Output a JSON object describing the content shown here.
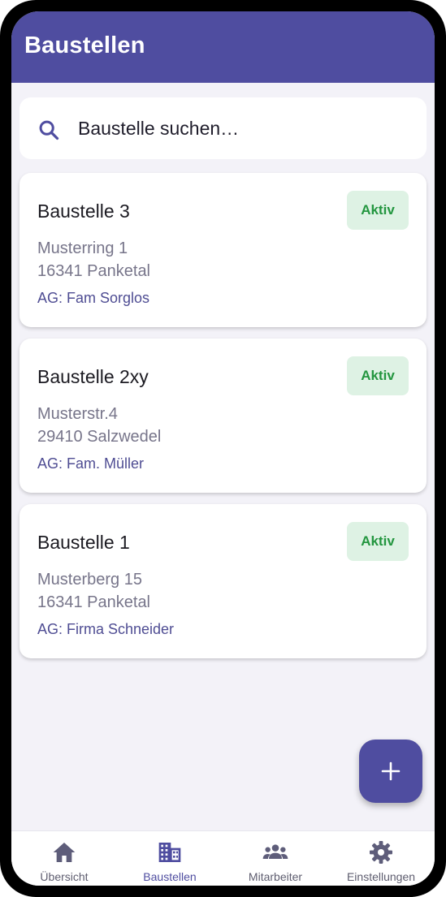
{
  "app_bar": {
    "title": "Baustellen"
  },
  "search": {
    "placeholder": "Baustelle suchen…",
    "icon": "search-icon"
  },
  "sites": [
    {
      "name": "Baustelle 3",
      "status": "Aktiv",
      "street": "Musterring 1",
      "city": "16341 Panketal",
      "client": "AG: Fam Sorglos"
    },
    {
      "name": "Baustelle 2xy",
      "status": "Aktiv",
      "street": "Musterstr.4",
      "city": "29410 Salzwedel",
      "client": "AG: Fam. Müller"
    },
    {
      "name": "Baustelle 1",
      "status": "Aktiv",
      "street": "Musterberg 15",
      "city": "16341 Panketal",
      "client": "AG: Firma Schneider"
    }
  ],
  "fab": {
    "icon": "plus-icon"
  },
  "bottom_nav": {
    "items": [
      {
        "label": "Übersicht",
        "icon": "home-icon"
      },
      {
        "label": "Baustellen",
        "icon": "building-icon",
        "active": true
      },
      {
        "label": "Mitarbeiter",
        "icon": "people-icon"
      },
      {
        "label": "Einstellungen",
        "icon": "gear-icon"
      }
    ]
  },
  "colors": {
    "primary": "#4f4da0",
    "background": "#f3f2f8",
    "status_bg": "#def2e4",
    "status_text": "#23963f",
    "secondary_text": "#77758a"
  }
}
